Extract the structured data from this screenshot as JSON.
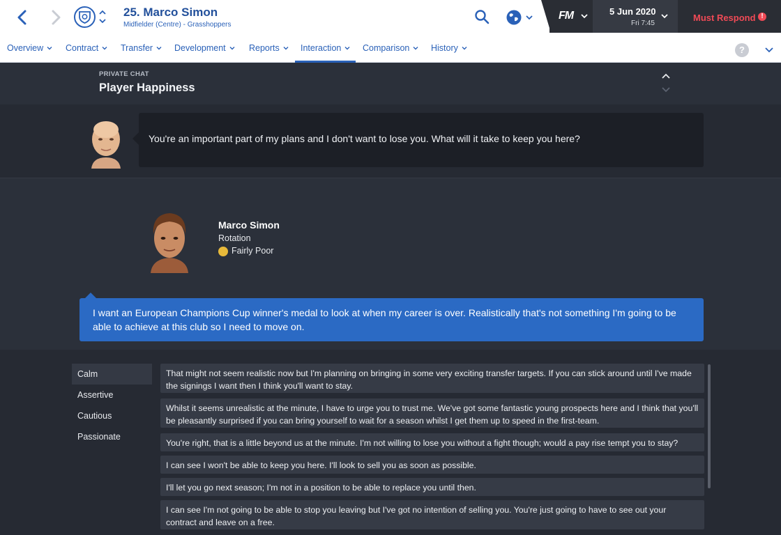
{
  "header": {
    "player_title": "25. Marco Simon",
    "player_subtitle": "Midfielder (Centre) - Grasshoppers",
    "fm_logo": "FM",
    "date": "5 Jun 2020",
    "day_time": "Fri 7:45",
    "must_respond": "Must Respond",
    "alert_glyph": "!",
    "icons": [
      "back-icon",
      "forward-icon",
      "club-badge-icon",
      "search-icon",
      "globe-icon",
      "alert-icon"
    ]
  },
  "tabs": [
    {
      "label": "Overview",
      "active": false
    },
    {
      "label": "Contract",
      "active": false
    },
    {
      "label": "Transfer",
      "active": false
    },
    {
      "label": "Development",
      "active": false
    },
    {
      "label": "Reports",
      "active": false
    },
    {
      "label": "Interaction",
      "active": true
    },
    {
      "label": "Comparison",
      "active": false
    },
    {
      "label": "History",
      "active": false
    }
  ],
  "help_glyph": "?",
  "section": {
    "label": "PRIVATE CHAT",
    "title": "Player Happiness"
  },
  "manager_message": "You're an important part of my plans and I don't want to lose you. What will it take to keep you here?",
  "player": {
    "name": "Marco Simon",
    "status": "Rotation",
    "happiness": "Fairly Poor",
    "message": "I want an European Champions Cup winner's medal to look at when my career is over. Realistically that's not something I'm going to be able to achieve at this club so I need to move on."
  },
  "tones": [
    {
      "label": "Calm",
      "selected": true
    },
    {
      "label": "Assertive",
      "selected": false
    },
    {
      "label": "Cautious",
      "selected": false
    },
    {
      "label": "Passionate",
      "selected": false
    }
  ],
  "replies": [
    "That might not seem realistic now but I'm planning on bringing in some very exciting transfer targets. If you can stick around until I've made the signings I want then I think you'll want to stay.",
    "Whilst it seems unrealistic at the minute, I have to urge you to trust me. We've got some fantastic young prospects here and I think that you'll be pleasantly surprised if you can bring yourself to wait for a season whilst I get them up to speed in the first-team.",
    "You're right, that is a little beyond us at the minute. I'm not willing to lose you without a fight though; would a pay rise tempt you to stay?",
    "I can see I won't be able to keep you here. I'll look to sell you as soon as possible.",
    "I'll let you go next season; I'm not in a position to be able to replace you until then.",
    "I can see I'm not going to be able to stop you leaving but I've got no intention of selling you. You're just going to have to see out your contract and leave on a free."
  ],
  "colors": {
    "accent": "#2a61b8",
    "alert": "#f04a56",
    "player_bubble": "#2b6ac4",
    "happiness": "#e8b93a"
  }
}
